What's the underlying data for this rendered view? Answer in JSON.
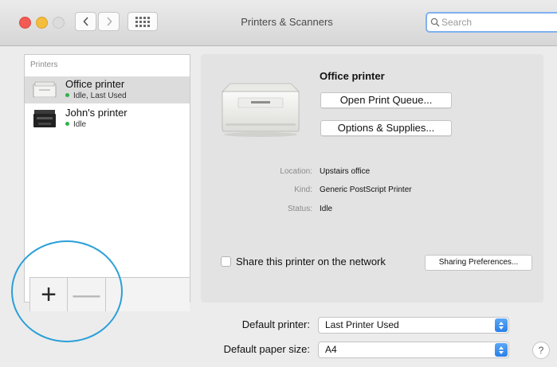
{
  "window": {
    "title": "Printers & Scanners"
  },
  "search": {
    "placeholder": "Search",
    "value": ""
  },
  "printer_list": {
    "header": "Printers",
    "items": [
      {
        "name": "Office printer",
        "status": "Idle, Last Used",
        "selected": true,
        "status_color": "#2fb24b"
      },
      {
        "name": "John's printer",
        "status": "Idle",
        "selected": false,
        "status_color": "#2fb24b"
      }
    ],
    "add_label": "+",
    "remove_label": "—"
  },
  "detail": {
    "name": "Office printer",
    "open_queue_label": "Open Print Queue...",
    "options_label": "Options & Supplies...",
    "location_label": "Location:",
    "location_value": "Upstairs office",
    "kind_label": "Kind:",
    "kind_value": "Generic PostScript Printer",
    "status_label": "Status:",
    "status_value": "Idle",
    "share_label": "Share this printer on the network",
    "share_checked": false,
    "sharing_prefs_label": "Sharing Preferences..."
  },
  "defaults": {
    "printer_label": "Default printer:",
    "printer_value": "Last Printer Used",
    "paper_label": "Default paper size:",
    "paper_value": "A4"
  },
  "help_label": "?",
  "colors": {
    "accent": "#2a7fe9",
    "highlight_ring": "#2a9fd8",
    "status_green": "#2fb24b"
  }
}
